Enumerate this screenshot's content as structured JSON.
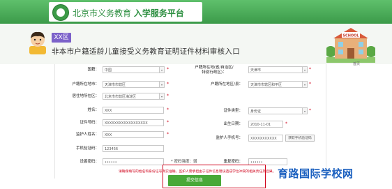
{
  "header": {
    "site_name": "北京市义务教育",
    "platform_name": "入学服务平台"
  },
  "banner": {
    "district_tag": "XX区",
    "page_heading": "非本市户籍适龄儿童接受义务教育证明证件材料审核入口",
    "scroll_hint": "首页"
  },
  "form": {
    "nationality": {
      "label": "国籍：",
      "value": "中国"
    },
    "household_region": {
      "label": "户籍所在地(省/自治区/特别行政区)：",
      "value": "天津市"
    },
    "household_city": {
      "label": "户籍所在地市：",
      "value": "天津市市辖区"
    },
    "household_district": {
      "label": "户籍所在地区/县：",
      "value": "天津市市辖区和平区"
    },
    "residence_district": {
      "label": "居住地所在区：",
      "value": "北京市市辖区海淀区"
    },
    "name": {
      "label": "姓名：",
      "value": "XXX"
    },
    "id_type": {
      "label": "证件类型：",
      "value": "身份证"
    },
    "id_number": {
      "label": "证件号码：",
      "value": "XXXXXXXXXXXXXXXXXX"
    },
    "birth_date": {
      "label": "出生日期：",
      "value": "2010-11-01"
    },
    "guardian_name": {
      "label": "监护人姓名：",
      "value": "XXX"
    },
    "guardian_phone": {
      "label": "监护人手机号：",
      "value": "XXXXXXXXXXX"
    },
    "check_phone_button": "获取手机验证码",
    "mobile_code": {
      "label": "手机验证码：",
      "value": "123456"
    },
    "password": {
      "label": "设置密码：",
      "value": "••••••"
    },
    "password_hint": "* 密码强度：弱",
    "confirm_password": {
      "label": "重复密码：",
      "value": "••••••"
    },
    "required_mark": "*"
  },
  "notice": {
    "text": "请确保填写的姓名和身份证号真实准确，监护人需承担由于证件信息错误造成学位冲突的相关责任及后果。"
  },
  "submit_label": "提交信息",
  "watermark": "育路国际学校网"
}
